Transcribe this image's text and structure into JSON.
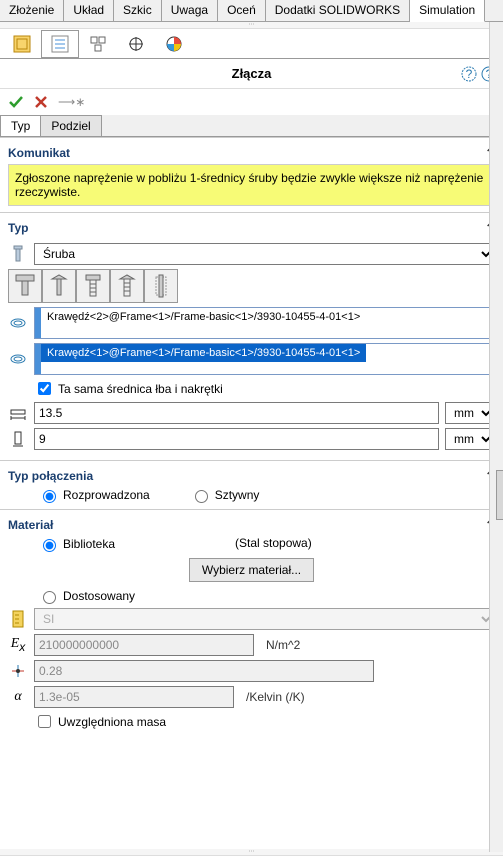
{
  "top_tabs": {
    "items": [
      "Złożenie",
      "Układ",
      "Szkic",
      "Uwaga",
      "Oceń",
      "Dodatki SOLIDWORKS",
      "Simulation"
    ],
    "active_index": 6
  },
  "panel": {
    "title": "Złącza"
  },
  "subtabs": {
    "items": [
      "Typ",
      "Podziel"
    ],
    "active_index": 0
  },
  "sections": {
    "komunikat": {
      "header": "Komunikat",
      "text": "Zgłoszone naprężenie w pobliżu 1-średnicy śruby będzie zwykle większe niż naprężenie rzeczywiste."
    },
    "typ": {
      "header": "Typ",
      "connector_type": "Śruba",
      "edge1": "Krawędź<2>@Frame<1>/Frame-basic<1>/3930-10455-4-01<1>",
      "edge2": "Krawędź<1>@Frame<1>/Frame-basic<1>/3930-10455-4-01<1>",
      "same_diameter_label": "Ta sama średnica łba i nakrętki",
      "diam1": "13.5",
      "diam2": "9",
      "unit": "mm"
    },
    "conn_type": {
      "header": "Typ połączenia",
      "opt1": "Rozprowadzona",
      "opt2": "Sztywny"
    },
    "material": {
      "header": "Materiał",
      "library_label": "Biblioteka",
      "mat_name": "(Stal stopowa)",
      "choose_btn": "Wybierz materiał...",
      "custom_label": "Dostosowany",
      "unit_system": "SI",
      "ex_val": "210000000000",
      "ex_unit": "N/m^2",
      "nu_val": "0.28",
      "alpha_val": "1.3e-05",
      "alpha_unit": "/Kelvin (/K)",
      "mass_label": "Uwzględniona masa"
    }
  }
}
